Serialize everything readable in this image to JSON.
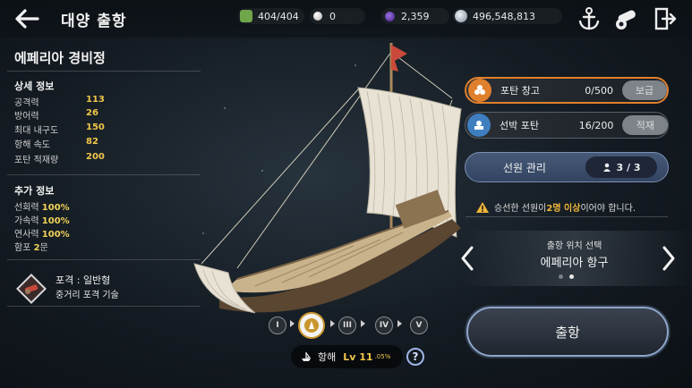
{
  "header": {
    "title": "대양 출항",
    "resources": [
      {
        "icon": "sailor-icon",
        "value": "404/404",
        "color": "#6fa64a"
      },
      {
        "icon": "pearl-icon",
        "value": "0",
        "color": "#d8d2cf"
      },
      {
        "icon": "crystal-icon",
        "value": "2,359",
        "color": "#6b3fb5"
      },
      {
        "icon": "silver-icon",
        "value": "496,548,813",
        "color": "#b9c4cf"
      }
    ],
    "buttons": [
      "anchor-icon",
      "cannon-icon",
      "exit-icon"
    ]
  },
  "ship": {
    "name": "에페리아 경비정",
    "detail_title": "상세 정보",
    "stats": [
      {
        "label": "공격력",
        "value": "113"
      },
      {
        "label": "방어력",
        "value": "26"
      },
      {
        "label": "최대 내구도",
        "value": "150"
      },
      {
        "label": "항해 속도",
        "value": "82"
      },
      {
        "label": "포탄 적재량",
        "value": "200"
      }
    ],
    "extra_title": "추가 정보",
    "extras": [
      {
        "label": "선회력",
        "value": "100%"
      },
      {
        "label": "가속력",
        "value": "100%"
      },
      {
        "label": "연사력",
        "value": "100%"
      },
      {
        "label": "함포",
        "value": "2",
        "suffix": "문"
      }
    ],
    "cannon_type": "포격 : 일반형",
    "cannon_skill": "중거리 포격 기술"
  },
  "tiers": {
    "items": [
      "I",
      "",
      "III",
      "IV",
      "V"
    ],
    "active_index": 1
  },
  "sailing": {
    "label": "항해",
    "level": "Lv 11",
    "percent": ".05%",
    "help": "?"
  },
  "right": {
    "cannon_storage": {
      "label": "포탄 창고",
      "count": "0/500",
      "action": "보급"
    },
    "ship_cannon": {
      "label": "선박 포탄",
      "count": "16/200",
      "action": "적재"
    },
    "crew": {
      "label": "선원 관리",
      "count": "3 / 3"
    },
    "warning": {
      "pre": "승선한 선원이 ",
      "highlight": "2명 이상",
      "post": "이어야 합니다."
    },
    "port": {
      "subtitle": "출항 위치 선택",
      "name": "에페리아 항구"
    },
    "depart": "출항"
  },
  "colors": {
    "accent_gold": "#f0c64a",
    "orange_border": "#e0802c",
    "blue_border": "#8fa6cc"
  }
}
